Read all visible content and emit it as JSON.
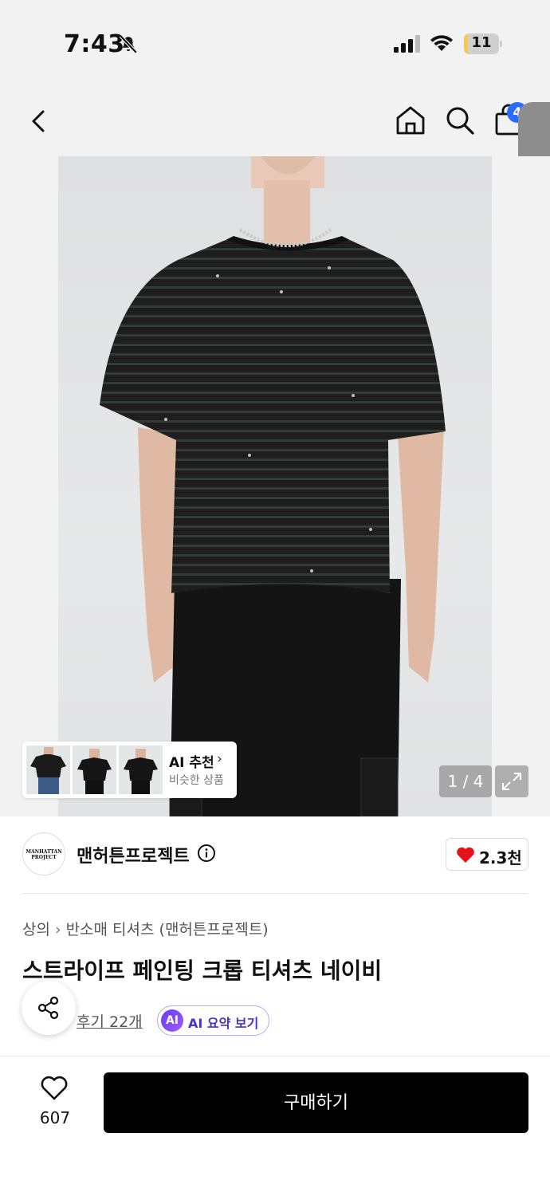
{
  "status_bar": {
    "time": "7:43",
    "battery": "11",
    "battery_level": 0.11
  },
  "nav": {
    "cart_count": "4"
  },
  "gallery": {
    "pager": "1 / 4"
  },
  "ai_recommend": {
    "title": "AI 추천",
    "subtitle": "비슷한 상품"
  },
  "brand": {
    "name": "맨허튼프로젝트",
    "logo_text": "MANHATTAN PROJECT",
    "likes": "2.3천"
  },
  "breadcrumb": {
    "level1": "상의",
    "level2": "반소매 티셔츠 (맨허튼프로젝트)"
  },
  "product": {
    "title": "스트라이프 페인팅 크롭 티셔츠 네이비"
  },
  "reviews": {
    "label": "후기 22개"
  },
  "ai_summary": {
    "badge": "AI",
    "label": "AI 요약 보기"
  },
  "bottom": {
    "wish_count": "607",
    "buy_label": "구매하기"
  },
  "colors": {
    "accent": "#2a6bff",
    "heart": "#e5121c",
    "ai": "#6a3df5"
  },
  "icons": [
    "bell-slash-icon",
    "signal-icon",
    "wifi-icon",
    "battery-icon",
    "back-icon",
    "home-icon",
    "search-icon",
    "shopping-bag-icon",
    "info-icon",
    "heart-icon",
    "share-icon",
    "expand-icon"
  ]
}
